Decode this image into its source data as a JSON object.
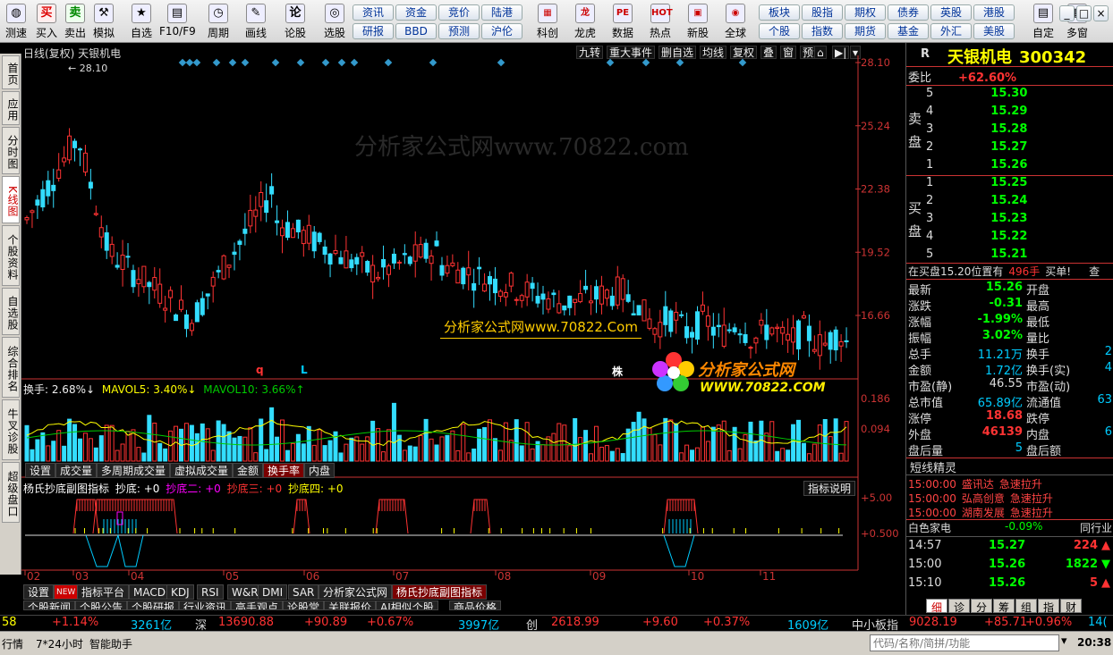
{
  "toolbar": {
    "buttons": [
      {
        "label": "测速",
        "icon": "speed-icon"
      },
      {
        "label": "买入",
        "icon": "buy-icon",
        "glyph": "买"
      },
      {
        "label": "卖出",
        "icon": "sell-icon",
        "glyph": "卖"
      },
      {
        "label": "模拟",
        "icon": "hammer-icon",
        "glyph": "⚒"
      },
      {
        "label": "自选",
        "icon": "star-icon",
        "glyph": "★"
      },
      {
        "label": "F10/F9",
        "icon": "f10-icon",
        "glyph": "▤"
      },
      {
        "label": "周期",
        "icon": "clock-icon",
        "glyph": "◷"
      },
      {
        "label": "画线",
        "icon": "pencil-icon",
        "glyph": "✎"
      },
      {
        "label": "论股",
        "icon": "chat-icon",
        "glyph": "论"
      },
      {
        "label": "选股",
        "icon": "select-icon",
        "glyph": "◎"
      }
    ],
    "quick_row1": [
      "资讯",
      "资金",
      "竞价",
      "陆港"
    ],
    "quick_row2": [
      "研报",
      "BBD",
      "预测",
      "沪伦"
    ],
    "big_buttons": [
      {
        "label": "科创",
        "glyph": "▦"
      },
      {
        "label": "龙虎",
        "glyph": "龙"
      },
      {
        "label": "数据",
        "glyph": "PE"
      },
      {
        "label": "热点",
        "glyph": "HOT"
      },
      {
        "label": "新股",
        "glyph": "▣"
      },
      {
        "label": "全球",
        "glyph": "◉"
      }
    ],
    "quick_row3": [
      "板块",
      "股指",
      "期权",
      "债券",
      "英股",
      "港股"
    ],
    "quick_row4": [
      "个股",
      "指数",
      "期货",
      "基金",
      "外汇",
      "美股"
    ],
    "right_buttons": [
      {
        "label": "自定",
        "glyph": "▤"
      },
      {
        "label": "多窗",
        "glyph": "▦"
      }
    ],
    "window_controls": [
      "_",
      "□",
      "×"
    ]
  },
  "side_tabs": [
    "首页",
    "应用",
    "分时图",
    "K线图",
    "个股资料",
    "自选股",
    "综合排名",
    "牛叉诊股",
    "超级盘口"
  ],
  "chart": {
    "header_left": "日线(复权)  天银机电",
    "header_buttons": [
      "九转",
      "重大事件",
      "删自选",
      "均线",
      "复权",
      "叠",
      "窗",
      "预测"
    ],
    "max_label": "28.10",
    "price_axis": [
      "28.10",
      "25.24",
      "22.38",
      "19.52",
      "16.66"
    ],
    "watermark": "分析家公式网www.70822.com",
    "watermark2": "分析家公式网www.70822.Com",
    "logo_text": "分析家公式网",
    "logo_url": "WWW.70822.COM",
    "markers": [
      "q",
      "L",
      "株"
    ],
    "vol_header": {
      "a": "换手: 2.68%↓",
      "b": "MAVOL5: 3.40%↓",
      "c": "MAVOL10: 3.66%↑"
    },
    "vol_axis": [
      "0.186",
      "0.094"
    ],
    "vol_tabs": [
      "设置",
      "成交量",
      "多周期成交量",
      "虚拟成交量",
      "金额",
      "换手率",
      "内盘"
    ],
    "vol_tab_active": "换手率",
    "ind_header": {
      "title": "杨氏抄底副图指标",
      "k1": "抄底: +0",
      "k2": "抄底二: +0",
      "k3": "抄底三: +0",
      "k4": "抄底四: +0"
    },
    "ind_button": "指标说明",
    "ind_axis": [
      "+5.00",
      "+0.500"
    ],
    "months": [
      "02",
      "03",
      "04",
      "05",
      "06",
      "07",
      "08",
      "09",
      "10",
      "11"
    ],
    "bottom_tabs": [
      "设置",
      "NEW",
      "指标平台",
      "MACD",
      "KDJ",
      "RSI",
      "W&R",
      "DMI",
      "SAR",
      "分析家公式网",
      "杨氏抄底副图指标"
    ],
    "bottom_tab_active": "杨氏抄底副图指标",
    "news_tabs": [
      "个股新闻",
      "个股公告",
      "个股研报",
      "行业资讯",
      "高手观点",
      "论股堂",
      "关联报价",
      "AI相似个股",
      "商品价格"
    ]
  },
  "quote": {
    "market": "R",
    "name": "天银机电",
    "code": "300342",
    "weibi_label": "委比",
    "weibi": "+62.60%",
    "sell_label": "卖盘",
    "buy_label": "买盘",
    "sell": [
      [
        "5",
        "15.30"
      ],
      [
        "4",
        "15.29"
      ],
      [
        "3",
        "15.28"
      ],
      [
        "2",
        "15.27"
      ],
      [
        "1",
        "15.26"
      ]
    ],
    "buy": [
      [
        "1",
        "15.25"
      ],
      [
        "2",
        "15.24"
      ],
      [
        "3",
        "15.23"
      ],
      [
        "4",
        "15.22"
      ],
      [
        "5",
        "15.21"
      ]
    ],
    "notice": "在买盘15.20位置有",
    "notice_vol": "496手",
    "notice_tail": "买单!",
    "notice_btn": "查",
    "stats_left": [
      [
        "最新",
        "15.26",
        "g"
      ],
      [
        "涨跌",
        "-0.31",
        "g"
      ],
      [
        "涨幅",
        "-1.99%",
        "g"
      ],
      [
        "振幅",
        "3.02%",
        "g"
      ],
      [
        "总手",
        "11.21万",
        "c"
      ],
      [
        "金额",
        "1.72亿",
        "c"
      ],
      [
        "市盈(静)",
        "46.55",
        "w"
      ],
      [
        "总市值",
        "65.89亿",
        "c"
      ],
      [
        "涨停",
        "18.68",
        "r"
      ],
      [
        "外盘",
        "46139",
        "r"
      ],
      [
        "盘后量",
        "5",
        "c"
      ]
    ],
    "stats_right": [
      "开盘",
      "最高",
      "最低",
      "量比",
      "换手",
      "换手(实)",
      "市盈(动)",
      "流通值",
      "跌停",
      "内盘",
      "盘后额"
    ],
    "stats_right_vals": [
      "",
      "",
      "",
      "",
      "2",
      "4",
      "",
      "63",
      "",
      "6",
      ""
    ],
    "sprite_title": "短线精灵",
    "sprite": [
      [
        "15:00:00",
        "盛讯达",
        "急速拉升"
      ],
      [
        "15:00:00",
        "弘高创意",
        "急速拉升"
      ],
      [
        "15:00:00",
        "湖南发展",
        "急速拉升"
      ]
    ],
    "sector": {
      "name": "白色家电",
      "chg": "-0.09%",
      "peer": "同行业"
    },
    "ticks": [
      [
        "14:57",
        "15.27",
        "224",
        "up"
      ],
      [
        "15:00",
        "15.26",
        "1822",
        "down"
      ],
      [
        "15:10",
        "15.26",
        "5",
        "up"
      ]
    ],
    "tabs": [
      "细",
      "诊",
      "分",
      "筹",
      "组",
      "指",
      "财"
    ]
  },
  "status": [
    {
      "t": "58",
      "c": "y"
    },
    {
      "t": "+1.14%",
      "c": "r"
    },
    {
      "t": "3261亿",
      "c": "c"
    },
    {
      "t": "深",
      "c": "w"
    },
    {
      "t": "13690.88",
      "c": "r"
    },
    {
      "t": "+90.89",
      "c": "r"
    },
    {
      "t": "+0.67%",
      "c": "r"
    },
    {
      "t": "3997亿",
      "c": "c"
    },
    {
      "t": "创",
      "c": "w"
    },
    {
      "t": "2618.99",
      "c": "r"
    },
    {
      "t": "+9.60",
      "c": "r"
    },
    {
      "t": "+0.37%",
      "c": "r"
    },
    {
      "t": "1609亿",
      "c": "c"
    },
    {
      "t": "中小板指",
      "c": "w"
    },
    {
      "t": "9028.19",
      "c": "r"
    },
    {
      "t": "+85.71",
      "c": "r"
    },
    {
      "t": "+0.96%",
      "c": "r"
    },
    {
      "t": "14(",
      "c": "c"
    }
  ],
  "bottombar": {
    "items": [
      "行情",
      "7*24小时",
      "智能助手"
    ],
    "search_placeholder": "代码/名称/简拼/功能",
    "time": "20:38"
  }
}
